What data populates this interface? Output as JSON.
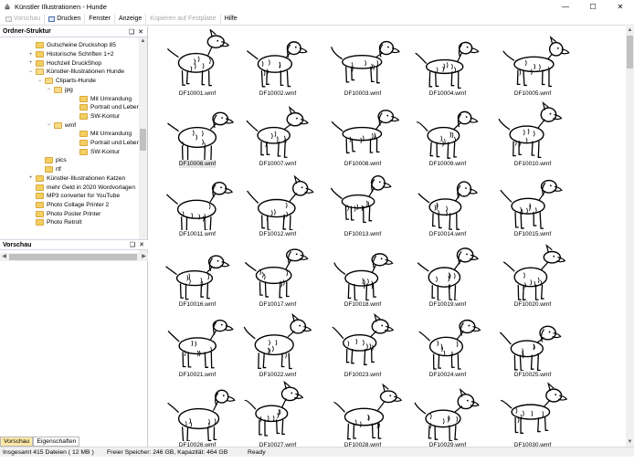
{
  "window": {
    "title": "Künstler Illustrationen - Hunde",
    "minimize": "—",
    "maximize": "☐",
    "close": "✕"
  },
  "menu": [
    {
      "label": "Vorschau",
      "disabled": true,
      "icon": "preview-icon"
    },
    {
      "label": "Drucken",
      "disabled": false,
      "icon": "printer-icon"
    },
    {
      "label": "Fenster",
      "disabled": false
    },
    {
      "label": "Anzeige",
      "disabled": false
    },
    {
      "label": "Kopieren auf Festplatte",
      "disabled": true
    },
    {
      "label": "Hilfe",
      "disabled": false
    }
  ],
  "folder_pane": {
    "title": "Ordner-Struktur",
    "pin": "❑",
    "close": "✕"
  },
  "tree": [
    {
      "label": "Gutscheine Druckshop 85",
      "level": 0,
      "expander": ""
    },
    {
      "label": "Historische Schriften 1+2",
      "level": 0,
      "expander": "+"
    },
    {
      "label": "Hochzeit DruckShop",
      "level": 0,
      "expander": "+"
    },
    {
      "label": "Künstler-Illustrationen Hunde",
      "level": 0,
      "expander": "−"
    },
    {
      "label": "Cliparts-Hunde",
      "level": 1,
      "expander": "−"
    },
    {
      "label": "jpg",
      "level": 2,
      "expander": "−"
    },
    {
      "label": "Mit Umrandung",
      "level": 3,
      "expander": ""
    },
    {
      "label": "Portrait und Leben",
      "level": 3,
      "expander": ""
    },
    {
      "label": "SW-Kontur",
      "level": 3,
      "expander": ""
    },
    {
      "label": "wmf",
      "level": 2,
      "expander": "−"
    },
    {
      "label": "Mit Umrandung",
      "level": 3,
      "expander": ""
    },
    {
      "label": "Portrait und Leben",
      "level": 3,
      "expander": ""
    },
    {
      "label": "SW-Kontur",
      "level": 3,
      "expander": ""
    },
    {
      "label": "pics",
      "level": 1,
      "expander": ""
    },
    {
      "label": "rtf",
      "level": 1,
      "expander": ""
    },
    {
      "label": "Künstler-Illustrationen Katzen",
      "level": 0,
      "expander": "+"
    },
    {
      "label": "mehr Geld in 2020 Wordvorlagen",
      "level": 0,
      "expander": ""
    },
    {
      "label": "MP3 converter for YouTube",
      "level": 0,
      "expander": ""
    },
    {
      "label": "Photo Collage Printer 2",
      "level": 0,
      "expander": ""
    },
    {
      "label": "Photo Poster Printer",
      "level": 0,
      "expander": ""
    },
    {
      "label": "Photo Retrolt",
      "level": 0,
      "expander": ""
    }
  ],
  "preview_pane": {
    "title": "Vorschau",
    "pin": "❑",
    "close": "✕"
  },
  "tabs": [
    {
      "label": "Vorschau",
      "active": true
    },
    {
      "label": "Eigenschaften",
      "active": false
    }
  ],
  "files": [
    "DF10001.wmf",
    "DF10002.wmf",
    "DF10003.wmf",
    "DF10004.wmf",
    "DF10005.wmf",
    "DF10006.wmf",
    "DF10007.wmf",
    "DF10008.wmf",
    "DF10009.wmf",
    "DF10010.wmf",
    "DF10011.wmf",
    "DF10012.wmf",
    "DF10013.wmf",
    "DF10014.wmf",
    "DF10015.wmf",
    "DF10016.wmf",
    "DF10017.wmf",
    "DF10018.wmf",
    "DF10019.wmf",
    "DF10020.wmf",
    "DF10021.wmf",
    "DF10022.wmf",
    "DF10023.wmf",
    "DF10024.wmf",
    "DF10025.wmf",
    "DF10026.wmf",
    "DF10027.wmf",
    "DF10028.wmf",
    "DF10029.wmf",
    "DF10030.wmf"
  ],
  "status": {
    "total": "Insgesamt 415 Dateien ( 12 MB )",
    "free": "Freier Speicher: 246 GB, Kapazität: 464 GB",
    "ready": "Ready"
  },
  "colors": {
    "selected_tab": "#ffe9a8",
    "folder": "#f3cf63"
  }
}
